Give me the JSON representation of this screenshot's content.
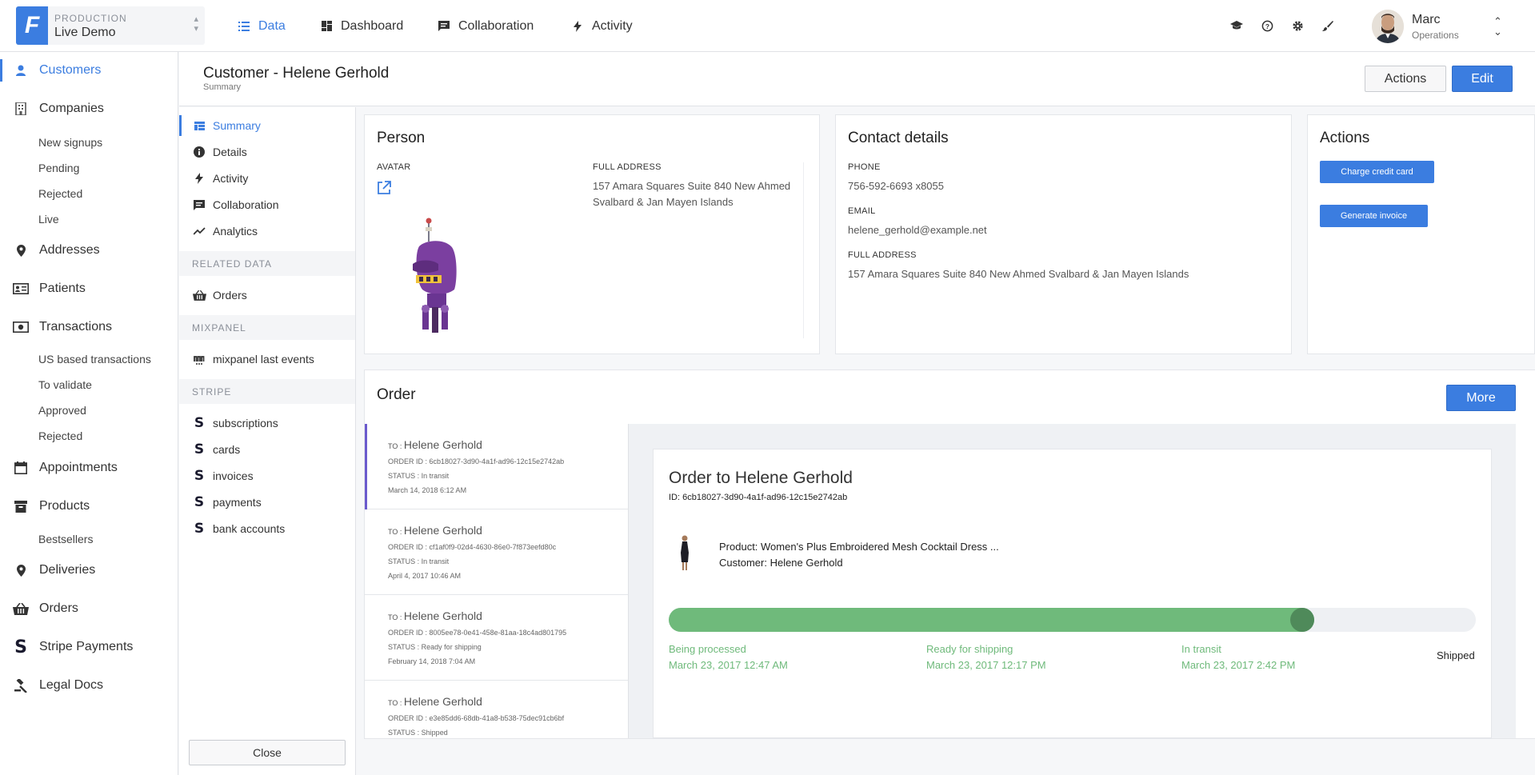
{
  "project": {
    "environment": "PRODUCTION",
    "name": "Live Demo",
    "logo_letter": "F"
  },
  "topnav": [
    {
      "label": "Data",
      "icon": "list-icon",
      "active": true
    },
    {
      "label": "Dashboard",
      "icon": "dashboard-icon"
    },
    {
      "label": "Collaboration",
      "icon": "comment-icon"
    },
    {
      "label": "Activity",
      "icon": "bolt-icon"
    }
  ],
  "toolbar_icons": [
    "graduation-cap-icon",
    "help-icon",
    "gear-icon",
    "brush-icon"
  ],
  "user": {
    "name": "Marc",
    "role": "Operations"
  },
  "sidebar": {
    "items": [
      {
        "label": "Customers",
        "icon": "person-icon",
        "active": true
      },
      {
        "label": "Companies",
        "icon": "building-icon"
      },
      {
        "label": "Addresses",
        "icon": "pin-icon"
      },
      {
        "label": "Patients",
        "icon": "id-card-icon"
      },
      {
        "label": "Transactions",
        "icon": "money-icon"
      },
      {
        "label": "Appointments",
        "icon": "calendar-icon"
      },
      {
        "label": "Products",
        "icon": "archive-icon"
      },
      {
        "label": "Deliveries",
        "icon": "pin-icon"
      },
      {
        "label": "Orders",
        "icon": "basket-icon"
      },
      {
        "label": "Stripe Payments",
        "icon": "stripe-icon"
      },
      {
        "label": "Legal Docs",
        "icon": "gavel-icon"
      }
    ],
    "companies_sub": [
      "New signups",
      "Pending",
      "Rejected",
      "Live"
    ],
    "transactions_sub": [
      "US based transactions",
      "To validate",
      "Approved",
      "Rejected"
    ],
    "products_sub": [
      "Bestsellers"
    ]
  },
  "header": {
    "title": "Customer - Helene Gerhold",
    "subtitle": "Summary",
    "actions_label": "Actions",
    "edit_label": "Edit"
  },
  "subnav": {
    "items": [
      {
        "label": "Summary",
        "icon": "summary-icon",
        "active": true
      },
      {
        "label": "Details",
        "icon": "info-icon"
      },
      {
        "label": "Activity",
        "icon": "bolt-icon"
      },
      {
        "label": "Collaboration",
        "icon": "comment-icon"
      },
      {
        "label": "Analytics",
        "icon": "chart-icon"
      }
    ],
    "related_title": "RELATED DATA",
    "related_items": [
      {
        "label": "Orders",
        "icon": "basket-icon"
      }
    ],
    "mixpanel_title": "MIXPANEL",
    "mixpanel_items": [
      {
        "label": "mixpanel last events",
        "icon": "mixpanel-icon"
      }
    ],
    "stripe_title": "STRIPE",
    "stripe_items": [
      "subscriptions",
      "cards",
      "invoices",
      "payments",
      "bank accounts"
    ],
    "stripe_glyph": "S",
    "close_label": "Close"
  },
  "person": {
    "title": "Person",
    "avatar_label": "AVATAR",
    "address_label": "FULL ADDRESS",
    "address_value": "157 Amara Squares Suite 840 New Ahmed Svalbard & Jan Mayen Islands"
  },
  "contact": {
    "title": "Contact details",
    "phone_label": "PHONE",
    "phone_value": "756-592-6693 x8055",
    "email_label": "EMAIL",
    "email_value": "helene_gerhold@example.net",
    "address_label": "FULL ADDRESS",
    "address_value": "157 Amara Squares Suite 840 New Ahmed Svalbard & Jan Mayen Islands"
  },
  "actions_card": {
    "title": "Actions",
    "charge_label": "Charge credit card",
    "invoice_label": "Generate invoice"
  },
  "order": {
    "title": "Order",
    "more_label": "More",
    "list": [
      {
        "to_prefix": "TO :",
        "to": "Helene Gerhold",
        "order_id": "ORDER ID : 6cb18027-3d90-4a1f-ad96-12c15e2742ab",
        "status": "STATUS : In transit",
        "date": "March 14, 2018 6:12 AM",
        "active": true
      },
      {
        "to_prefix": "TO :",
        "to": "Helene Gerhold",
        "order_id": "ORDER ID : cf1af0f9-02d4-4630-86e0-7f873eefd80c",
        "status": "STATUS : In transit",
        "date": "April 4, 2017 10:46 AM"
      },
      {
        "to_prefix": "TO :",
        "to": "Helene Gerhold",
        "order_id": "ORDER ID : 8005ee78-0e41-458e-81aa-18c4ad801795",
        "status": "STATUS : Ready for shipping",
        "date": "February 14, 2018 7:04 AM"
      },
      {
        "to_prefix": "TO :",
        "to": "Helene Gerhold",
        "order_id": "ORDER ID : e3e85dd6-68db-41a8-b538-75dec91cb6bf",
        "status": "STATUS : Shipped",
        "date": ""
      }
    ],
    "detail": {
      "title": "Order to Helene Gerhold",
      "id_line": "ID: 6cb18027-3d90-4a1f-ad96-12c15e2742ab",
      "product_line": "Product: Women's Plus Embroidered Mesh Cocktail Dress ...",
      "customer_line": "Customer: Helene Gerhold",
      "progress_fraction": 0.8,
      "steps": [
        {
          "label": "Being processed",
          "date": "March 23, 2017 12:47 AM"
        },
        {
          "label": "Ready for shipping",
          "date": "March 23, 2017 12:17 PM"
        },
        {
          "label": "In transit",
          "date": "March 23, 2017 2:42 PM"
        }
      ],
      "last_step": "Shipped"
    }
  }
}
